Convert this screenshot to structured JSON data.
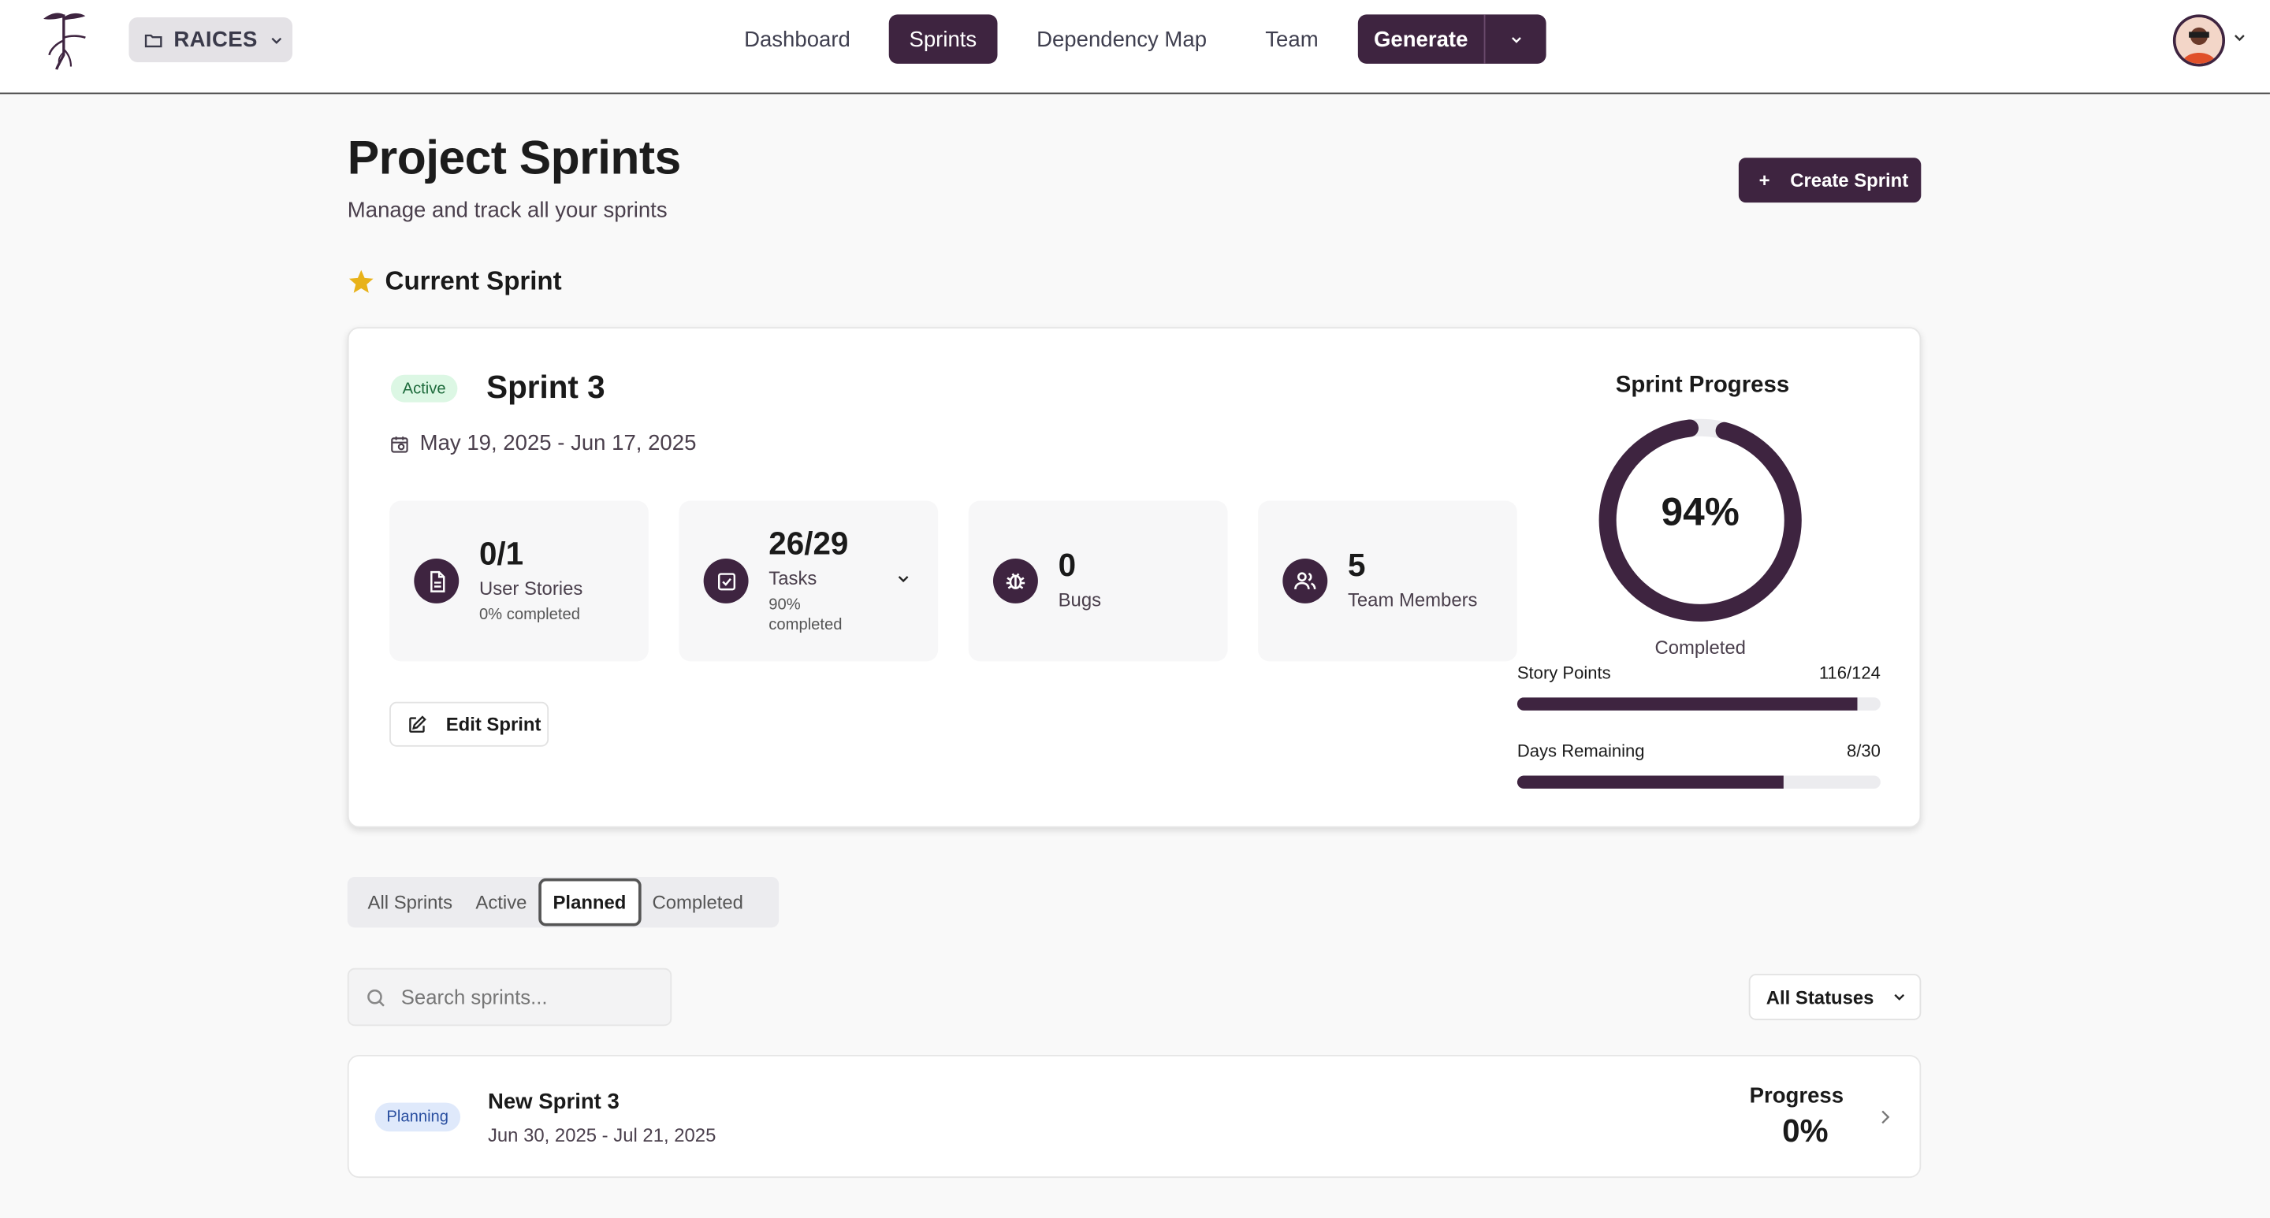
{
  "header": {
    "project": "RAICES",
    "nav": [
      "Dashboard",
      "Sprints",
      "Dependency Map",
      "Team"
    ],
    "active_nav": "Sprints",
    "generate_label": "Generate"
  },
  "page": {
    "title": "Project Sprints",
    "subtitle": "Manage and track all your sprints",
    "create_label": "Create Sprint",
    "current_sprint_heading": "Current Sprint"
  },
  "current": {
    "status": "Active",
    "name": "Sprint 3",
    "dates": "May 19, 2025 - Jun 17, 2025",
    "stats": {
      "stories_value": "0/1",
      "stories_label": "User Stories",
      "stories_sub": "0% completed",
      "tasks_value": "26/29",
      "tasks_label": "Tasks",
      "tasks_sub": "90% completed",
      "bugs_value": "0",
      "bugs_label": "Bugs",
      "team_value": "5",
      "team_label": "Team Members"
    },
    "edit_label": "Edit Sprint",
    "progress_title": "Sprint Progress",
    "progress_value": "94%",
    "progress_fraction": 0.94,
    "progress_caption": "Completed",
    "story_points_label": "Story Points",
    "story_points_value": "116/124",
    "story_points_fraction": 0.935,
    "days_label": "Days Remaining",
    "days_value": "8/30",
    "days_fraction": 0.733
  },
  "tabs": [
    "All Sprints",
    "Active",
    "Planned",
    "Completed"
  ],
  "selected_tab": "Planned",
  "search": {
    "placeholder": "Search sprints..."
  },
  "status_filter": "All Statuses",
  "sprints": [
    {
      "status": "Planning",
      "name": "New Sprint 3",
      "dates": "Jun 30, 2025 - Jul 21, 2025",
      "progress_label": "Progress",
      "progress": "0%"
    }
  ],
  "colors": {
    "accent": "#3e2440",
    "star": "#e8b21a",
    "active_badge": "#dcf7e4",
    "planning_badge": "#dfe9fb"
  }
}
